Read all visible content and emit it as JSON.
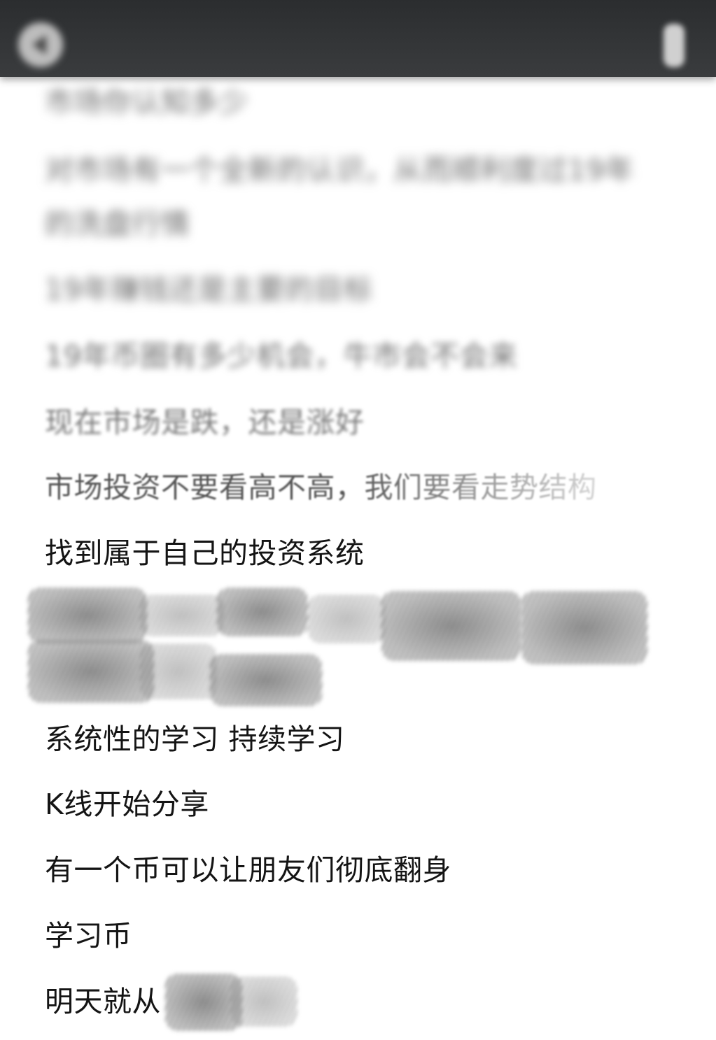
{
  "app_bar": {
    "title": "",
    "subtitle": "",
    "back_icon": "arrow-left-icon",
    "menu_icon": "more-vertical-icon"
  },
  "message": {
    "lines": [
      "市场你认知多少",
      "对市场有一个全新的认识，从而顺利度过19年",
      "的洗盘行情",
      "19年赚钱还是主要的目标",
      "19年币圈有多少机会，牛市会不会来",
      "现在市场是跌，还是涨好",
      "市场投资不要看高不高，我们要看走势结构",
      "找到属于自己的投资系统",
      "系统性的学习  持续学习",
      "K线开始分享",
      "有一个币可以让朋友们彻底翻身",
      "学习币",
      "明天就从"
    ]
  }
}
